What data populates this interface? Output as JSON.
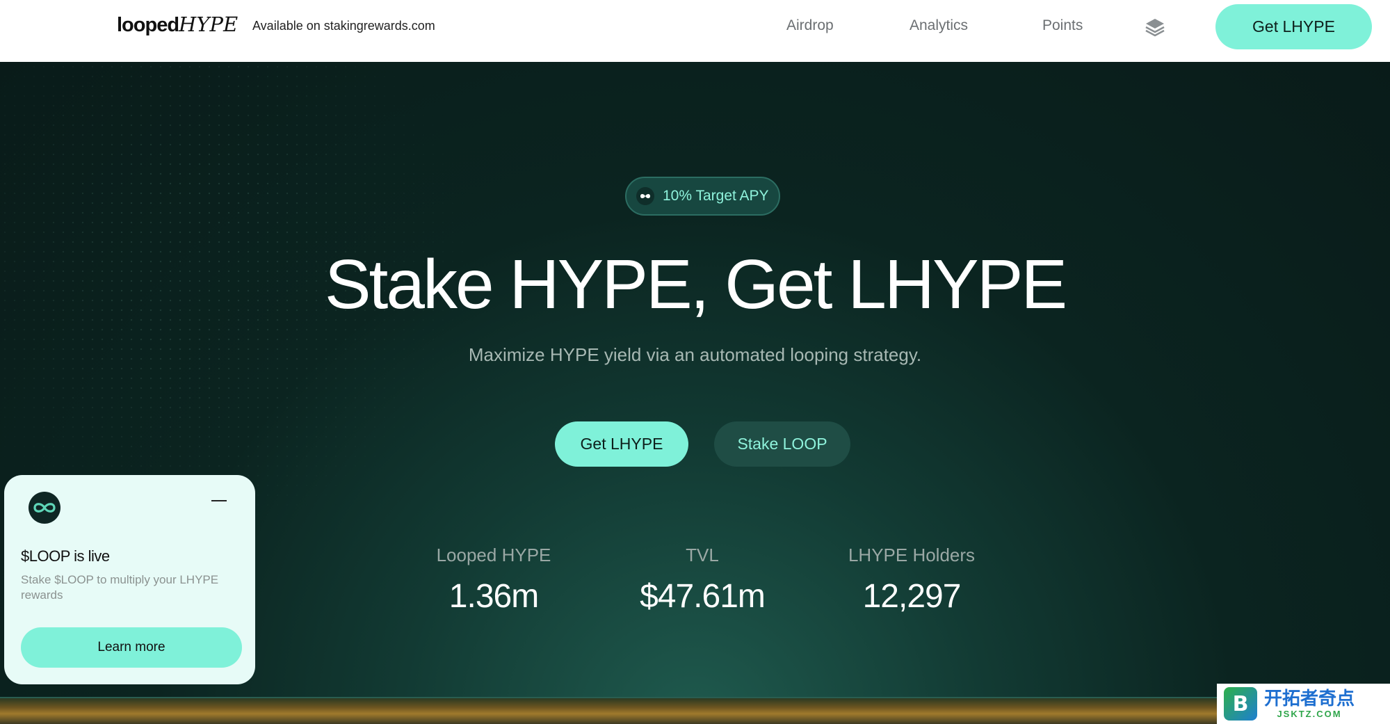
{
  "header": {
    "logo_main": "looped",
    "logo_accent": "HYPE",
    "availability": "Available on stakingrewards.com",
    "nav": [
      "Airdrop",
      "Analytics",
      "Points"
    ],
    "cta": "Get LHYPE"
  },
  "hero": {
    "badge": "10% Target APY",
    "title": "Stake HYPE, Get LHYPE",
    "subtitle": "Maximize HYPE yield via an automated looping strategy.",
    "primary_cta": "Get LHYPE",
    "secondary_cta": "Stake LOOP",
    "stats": [
      {
        "label": "Looped HYPE",
        "value": "1.36m"
      },
      {
        "label": "TVL",
        "value": "$47.61m"
      },
      {
        "label": "LHYPE Holders",
        "value": "12,297"
      }
    ]
  },
  "popup": {
    "title": "$LOOP is live",
    "description": "Stake $LOOP to multiply your LHYPE rewards",
    "button": "Learn more"
  },
  "watermark": {
    "badge": "B",
    "name": "开拓者奇点",
    "domain": "JSKTZ.COM"
  },
  "colors": {
    "accent": "#7ff1d9",
    "hero_bg": "#0b2420",
    "header_bg": "#ffffff",
    "popup_bg": "#e7fbf7"
  },
  "icons": [
    "layers-icon",
    "infinity-icon",
    "loop-logo-icon"
  ]
}
